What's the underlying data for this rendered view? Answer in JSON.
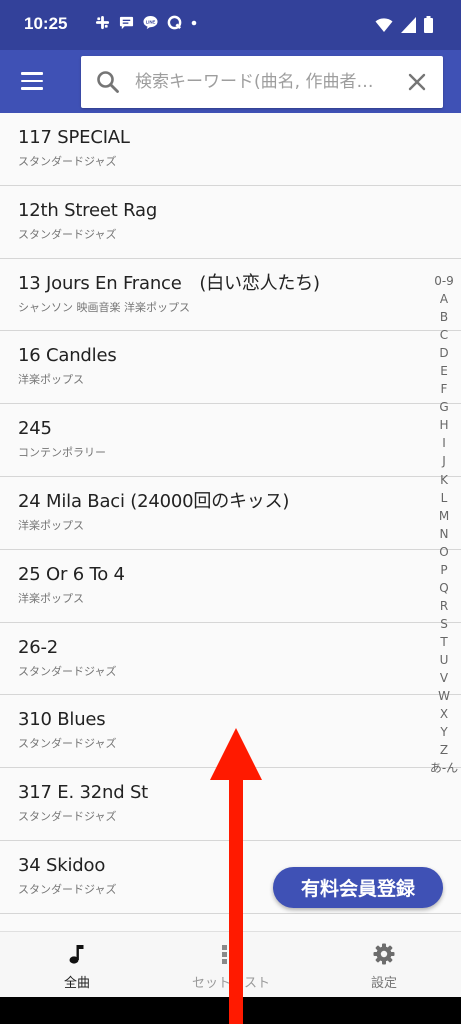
{
  "status_bar": {
    "time": "10:25",
    "notification_icons": [
      "slack-icon",
      "chat-bubble-icon",
      "line-icon",
      "q-app-icon",
      "dot-icon"
    ],
    "system_icons": [
      "wifi-icon",
      "signal-icon",
      "battery-icon"
    ]
  },
  "app_bar": {
    "menu_icon": "hamburger-icon",
    "search": {
      "placeholder": "検索キーワード(曲名, 作曲者…",
      "value": ""
    },
    "clear_icon": "close-icon"
  },
  "songs": [
    {
      "title": "117 SPECIAL",
      "genre": "スタンダードジャズ"
    },
    {
      "title": "12th Street Rag",
      "genre": "スタンダードジャズ"
    },
    {
      "title": "13 Jours En France　(白い恋人たち)",
      "genre": "シャンソン 映画音楽 洋楽ポップス"
    },
    {
      "title": "16 Candles",
      "genre": "洋楽ポップス"
    },
    {
      "title": "245",
      "genre": "コンテンポラリー"
    },
    {
      "title": "24 Mila Baci (24000回のキッス)",
      "genre": "洋楽ポップス"
    },
    {
      "title": "25 Or 6 To 4",
      "genre": "洋楽ポップス"
    },
    {
      "title": "26-2",
      "genre": "スタンダードジャズ"
    },
    {
      "title": "310 Blues",
      "genre": "スタンダードジャズ"
    },
    {
      "title": "317 E. 32nd St",
      "genre": "スタンダードジャズ"
    },
    {
      "title": "34 Skidoo",
      "genre": "スタンダードジャズ"
    },
    {
      "title": "",
      "genre": ""
    }
  ],
  "alpha_index": [
    "0-9",
    "A",
    "B",
    "C",
    "D",
    "E",
    "F",
    "G",
    "H",
    "I",
    "J",
    "K",
    "L",
    "M",
    "N",
    "O",
    "P",
    "Q",
    "R",
    "S",
    "T",
    "U",
    "V",
    "W",
    "X",
    "Y",
    "Z",
    "あ-ん"
  ],
  "premium_button": "有料会員登録",
  "bottom_nav": {
    "all_songs": {
      "label": "全曲",
      "icon": "music-note-icon"
    },
    "setlist": {
      "label": "セットリスト",
      "icon": "grid-icon"
    },
    "settings": {
      "label": "設定",
      "icon": "gear-icon"
    }
  },
  "colors": {
    "status_bar": "#33419a",
    "app_bar": "#3f51b5",
    "premium_button": "#3f51b5",
    "overlay_arrow": "#ff1a00"
  },
  "overlay": {
    "arrow_direction": "up",
    "arrow_icon": "swipe-up-arrow"
  }
}
